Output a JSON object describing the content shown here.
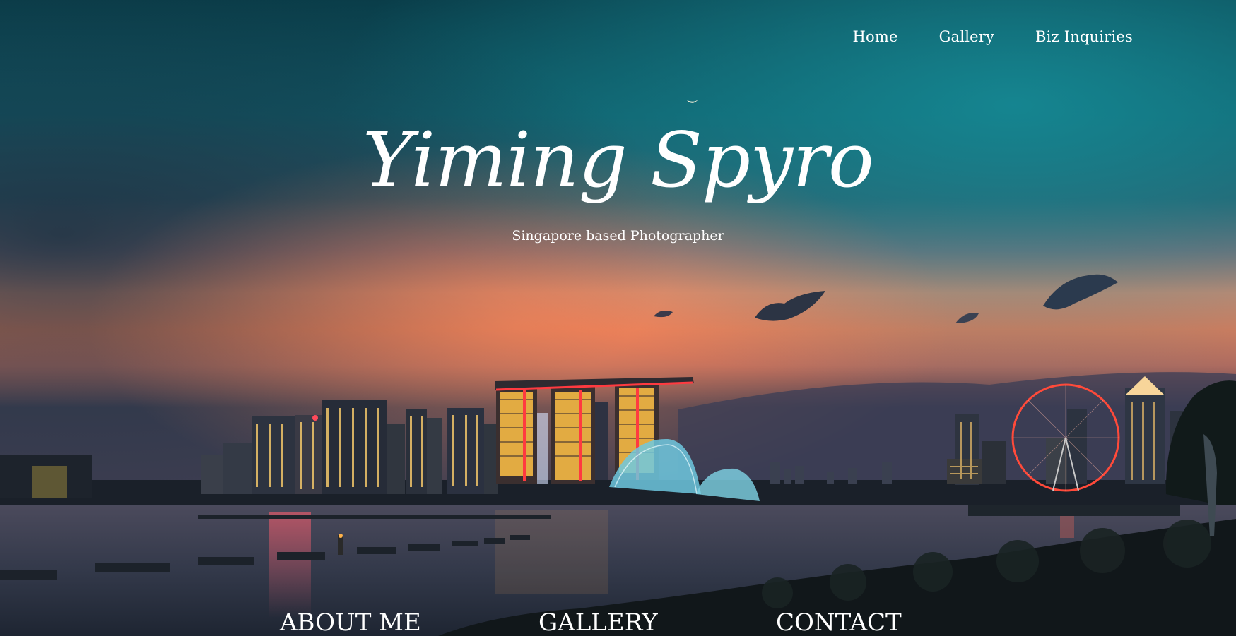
{
  "nav": {
    "items": [
      {
        "label": "Home"
      },
      {
        "label": "Gallery"
      },
      {
        "label": "Biz Inquiries"
      }
    ]
  },
  "hero": {
    "title": "Yiming Spyro",
    "subtitle": "Singapore based Photographer",
    "background": "night-skyline-photo"
  },
  "sections": {
    "about_label": "ABOUT ME",
    "gallery_label": "GALLERY",
    "contact_label": "CONTACT"
  },
  "colors": {
    "text": "#ffffff",
    "sky_top": "#0b4450",
    "sky_teal": "#14707c",
    "sunset": "#e9866a",
    "water": "#2e3644"
  }
}
